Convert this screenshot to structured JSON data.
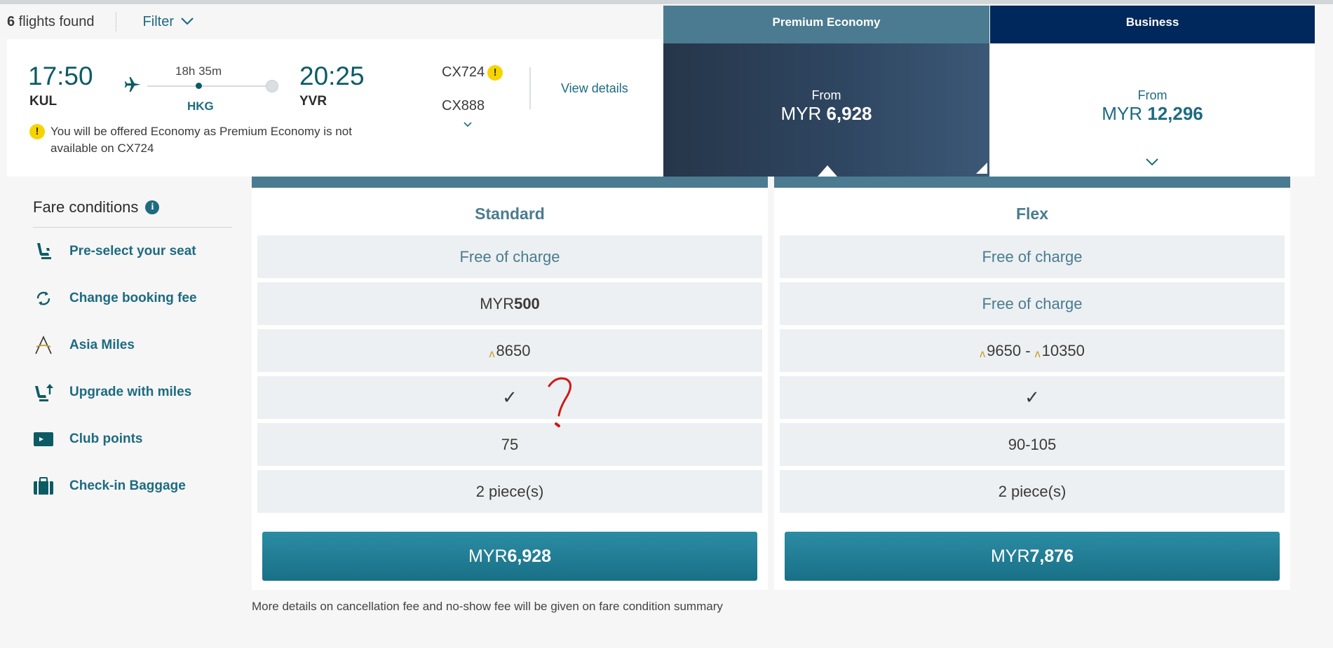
{
  "results": {
    "count": "6",
    "label": " flights found",
    "filter_label": "Filter"
  },
  "flight": {
    "depart_time": "17:50",
    "depart_airport": "KUL",
    "duration": "18h 35m",
    "via": "HKG",
    "arrive_time": "20:25",
    "arrive_airport": "YVR",
    "flight_1": "CX724",
    "flight_2": "CX888",
    "view_details": "View details",
    "notice": "You will be offered Economy as Premium Economy is not available on CX724",
    "warning_glyph": "!"
  },
  "cabins": [
    {
      "name": "Premium Economy",
      "from": "From",
      "currency": "MYR ",
      "amount": "6,928"
    },
    {
      "name": "Business",
      "from": "From",
      "currency": "MYR ",
      "amount": "12,296"
    }
  ],
  "fare_conditions": {
    "title": "Fare conditions",
    "info_glyph": "i",
    "rows": [
      {
        "label": "Pre-select your seat",
        "icon": "seat-icon"
      },
      {
        "label": "Change booking fee",
        "icon": "refresh-icon"
      },
      {
        "label": "Asia Miles",
        "icon": "asia-miles-icon"
      },
      {
        "label": "Upgrade with miles",
        "icon": "seat-upgrade-icon"
      },
      {
        "label": "Club points",
        "icon": "club-card-icon"
      },
      {
        "label": "Check-in Baggage",
        "icon": "baggage-icon"
      }
    ]
  },
  "fares": [
    {
      "name": "Standard",
      "seat": "Free of charge",
      "change_currency": "MYR",
      "change_amount": "500",
      "miles": "8650",
      "upgrade": "✓",
      "club_points": "75",
      "baggage": "2 piece(s)",
      "price_currency": "MYR",
      "price_amount": "6,928"
    },
    {
      "name": "Flex",
      "seat": "Free of charge",
      "change": "Free of charge",
      "miles_low": "9650",
      "miles_sep": " - ",
      "miles_high": "10350",
      "upgrade": "✓",
      "club_points": "90-105",
      "baggage": "2 piece(s)",
      "price_currency": "MYR",
      "price_amount": "7,876"
    }
  ],
  "miles_glyph": "ʌ",
  "footnote": "More details on cancellation fee and no-show fee will be given on fare condition summary",
  "annotation": "?",
  "colors": {
    "teal": "#1d6b81",
    "dark_teal": "#0c5b64",
    "steel": "#4b7b90",
    "navy": "#00285c",
    "warning": "#f6d400"
  }
}
